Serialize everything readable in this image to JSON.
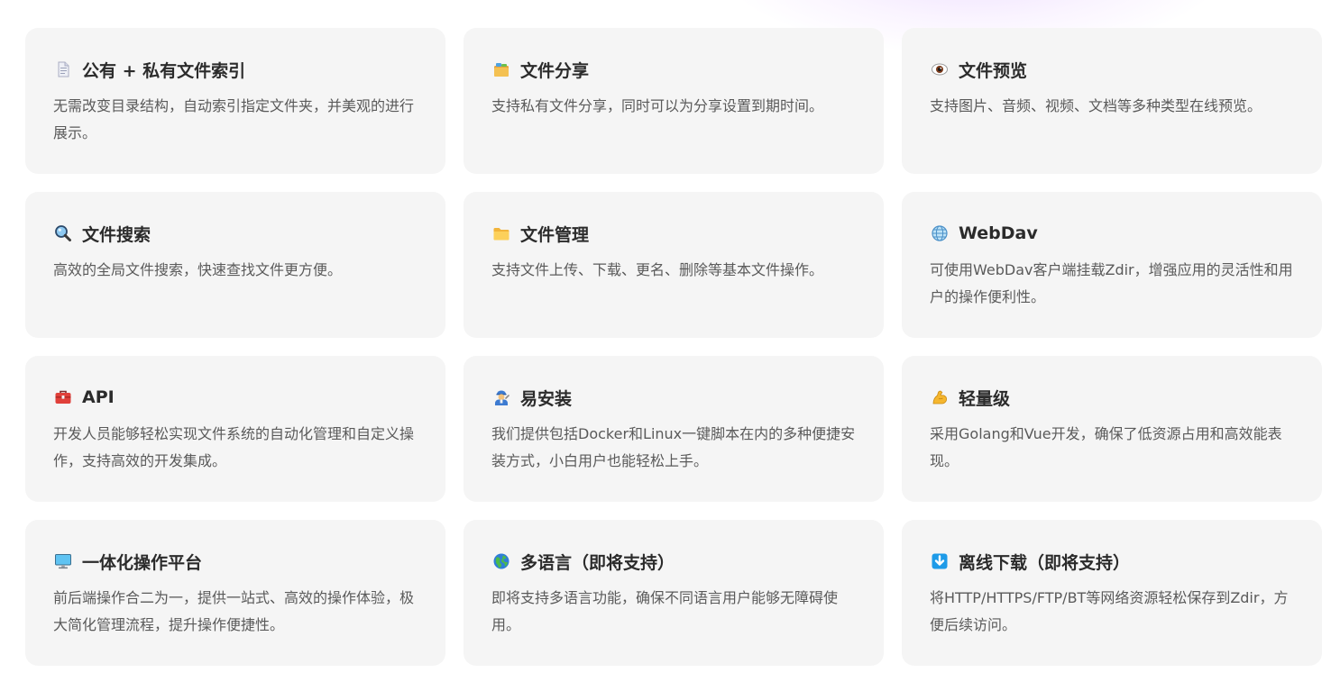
{
  "accent_glow": "#e0c4ff",
  "features": [
    {
      "icon": "document-icon",
      "title": "公有 + 私有文件索引",
      "desc": "无需改变目录结构，自动索引指定文件夹，并美观的进行展示。"
    },
    {
      "icon": "card-index-dividers-icon",
      "title": "文件分享",
      "desc": "支持私有文件分享，同时可以为分享设置到期时间。"
    },
    {
      "icon": "eye-icon",
      "title": "文件预览",
      "desc": "支持图片、音频、视频、文档等多种类型在线预览。"
    },
    {
      "icon": "magnifier-icon",
      "title": "文件搜索",
      "desc": "高效的全局文件搜索，快速查找文件更方便。"
    },
    {
      "icon": "folder-icon",
      "title": "文件管理",
      "desc": "支持文件上传、下载、更名、删除等基本文件操作。"
    },
    {
      "icon": "globe-icon",
      "title": "WebDav",
      "desc": "可使用WebDav客户端挂载Zdir，增强应用的灵活性和用户的操作便利性。"
    },
    {
      "icon": "toolbox-icon",
      "title": "API",
      "desc": "开发人员能够轻松实现文件系统的自动化管理和自定义操作，支持高效的开发集成。"
    },
    {
      "icon": "mechanic-icon",
      "title": "易安装",
      "desc": "我们提供包括Docker和Linux一键脚本在内的多种便捷安装方式，小白用户也能轻松上手。"
    },
    {
      "icon": "flexed-arm-icon",
      "title": "轻量级",
      "desc": "采用Golang和Vue开发，确保了低资源占用和高效能表现。"
    },
    {
      "icon": "desktop-computer-icon",
      "title": "一体化操作平台",
      "desc": "前后端操作合二为一，提供一站式、高效的操作体验，极大简化管理流程，提升操作便捷性。"
    },
    {
      "icon": "earth-globe-icon",
      "title": "多语言（即将支持）",
      "desc": "即将支持多语言功能，确保不同语言用户能够无障碍使用。"
    },
    {
      "icon": "down-arrow-icon",
      "title": "离线下载（即将支持）",
      "desc": "将HTTP/HTTPS/FTP/BT等网络资源轻松保存到Zdir，方便后续访问。"
    }
  ]
}
